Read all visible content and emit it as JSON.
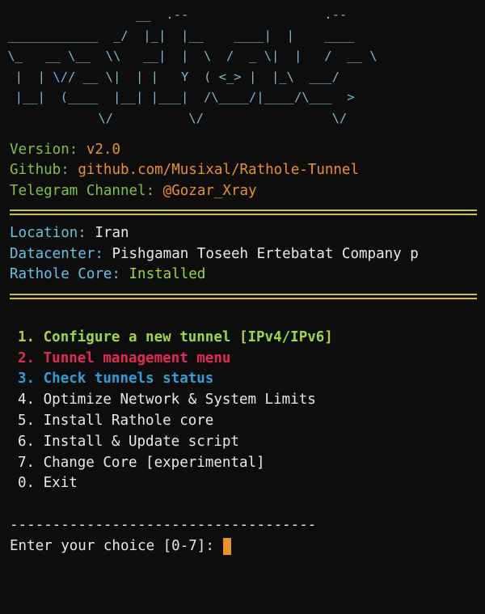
{
  "terminal": {
    "background_color": "#0d0d0d",
    "banner_color": "#7cb7d6",
    "ascii_banner": "                  __  .--                  .--\n ____________  _/  |_|  |__    ____|  |    ____\n \\_   __ \\__  \\\\   __|  |  \\  /  _ \\|  |   /  __ \\\n  |  | \\// __ \\|  | |   Y  ( <_> |  |_\\  ___/\n  |__|  (____  |__| |___|  /\\____/|____/\\___  >\n             \\/          \\/                 \\/"
  },
  "info": {
    "version_label": "Version:",
    "version_value": "v2.0",
    "github_label": "Github:",
    "github_value": "github.com/Musixal/Rathole-Tunnel",
    "telegram_label": "Telegram Channel:",
    "telegram_value": "@Gozar_Xray"
  },
  "system": {
    "location_label": "Location:",
    "location_value": "Iran",
    "datacenter_label": "Datacenter:",
    "datacenter_value": "Pishgaman Toseeh Ertebatat Company p",
    "core_label": "Rathole Core:",
    "core_value": "Installed"
  },
  "menu": {
    "items": [
      {
        "num": "1.",
        "label": "Configure a new tunnel [IPv4/IPv6]",
        "style": "bold-lime"
      },
      {
        "num": "2.",
        "label": "Tunnel management menu",
        "style": "bold-crimson"
      },
      {
        "num": "3.",
        "label": "Check tunnels status",
        "style": "bold-blue"
      },
      {
        "num": "4.",
        "label": "Optimize Network & System Limits",
        "style": "plain"
      },
      {
        "num": "5.",
        "label": "Install Rathole core",
        "style": "plain"
      },
      {
        "num": "6.",
        "label": "Install & Update script",
        "style": "plain"
      },
      {
        "num": "7.",
        "label": "Change Core [experimental]",
        "style": "plain"
      },
      {
        "num": "0.",
        "label": "Exit",
        "style": "plain"
      }
    ]
  },
  "prompt": {
    "divider": "------------------------------------",
    "text": "Enter your choice [0-7]: ",
    "cursor_color": "#e8922e"
  },
  "colors": {
    "green": "#7ec14a",
    "orange": "#e8922e",
    "cyan": "#63c4e0",
    "lime": "#a4d442",
    "crimson": "#e02b5a",
    "blue": "#2e9fd4",
    "white": "#e9e9e9",
    "separator_yellow": "#cbbd55"
  }
}
